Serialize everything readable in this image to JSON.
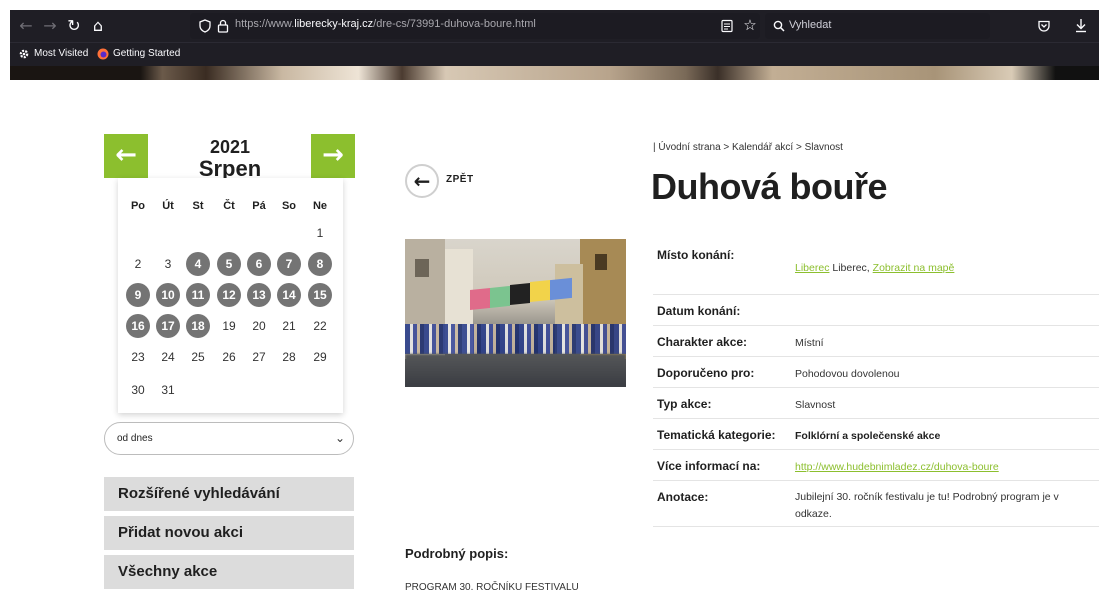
{
  "browser": {
    "url_prefix": "https://www.",
    "url_domain": "liberecky-kraj.cz",
    "url_path": "/dre-cs/73991-duhova-boure.html",
    "search_placeholder": "Vyhledat",
    "bookmarks": [
      {
        "label": "Most Visited",
        "icon": "gear-icon"
      },
      {
        "label": "Getting Started",
        "icon": "firefox-icon"
      }
    ]
  },
  "calendar": {
    "year": "2021",
    "month": "Srpen",
    "weekdays": [
      "Po",
      "Út",
      "St",
      "Čt",
      "Pá",
      "So",
      "Ne"
    ],
    "first_weekday_index": 6,
    "days_in_month": 31,
    "event_days": [
      4,
      5,
      6,
      7,
      8,
      9,
      10,
      11,
      12,
      13,
      14,
      15,
      16,
      17,
      18
    ],
    "accent_color": "#8cbf2e",
    "event_color": "#747474"
  },
  "period_select": {
    "selected": "od dnes"
  },
  "sidebar_buttons": [
    "Rozšířené vyhledávání",
    "Přidat novou akci",
    "Všechny akce"
  ],
  "back": {
    "label": "ZPĚT"
  },
  "breadcrumb": "| Úvodní strana > Kalendář akcí > Slavnost",
  "title": "Duhová bouře",
  "details": {
    "place_label": "Místo konání:",
    "place_link": "Liberec",
    "place_text": " Liberec, ",
    "map_link": "Zobrazit na mapě",
    "date_label": "Datum konání:",
    "date_value": "",
    "character_label": "Charakter akce:",
    "character_value": "Místní",
    "recommended_label": "Doporučeno pro:",
    "recommended_value": "Pohodovou dovolenou",
    "type_label": "Typ akce:",
    "type_value": "Slavnost",
    "category_label": "Tematická kategorie:",
    "category_value": "Folklórní a společenské akce",
    "more_label": "Více informací na:",
    "more_link": "http://www.hudebnimladez.cz/duhova-boure",
    "annotation_label": "Anotace:",
    "annotation_line1": "Jubilejní 30. ročník festivalu je tu! Podrobný program je v",
    "annotation_line2": "odkaze."
  },
  "description": {
    "heading": "Podrobný popis:",
    "text": "PROGRAM 30. ROČNÍKU FESTIVALU"
  }
}
